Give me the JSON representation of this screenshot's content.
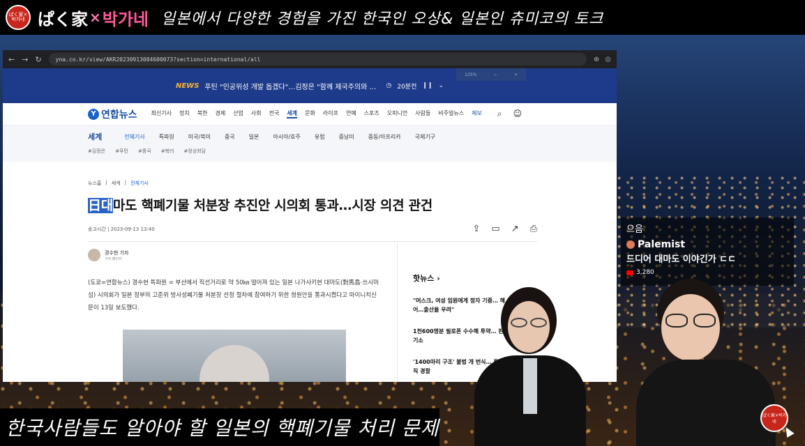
{
  "banner": {
    "brand_a": "ぱく家",
    "brand_x": "×",
    "brand_b": "박가네",
    "tagline": "일본에서 다양한 경험을 가진 한국인 오상& 일본인 츄미코의 토크",
    "logo_text": "ぱく家×박가네"
  },
  "browser": {
    "url": "yna.co.kr/view/AKR20230913084600073?section=international/all",
    "newsbar": {
      "label": "NEWS",
      "text": "푸틴 \"인공위성 개발 돕겠다\"…김정은 \"함께 제국주의와 …",
      "timer": "20분전",
      "zoom": "125%"
    },
    "site": {
      "logo_mark": "Y",
      "logo_name": "연합뉴스",
      "nav": [
        "최신기사",
        "정치",
        "북한",
        "경제",
        "산업",
        "사회",
        "전국",
        "세계",
        "문화",
        "라이프",
        "연예",
        "스포츠",
        "오피니언",
        "사람들",
        "비주얼뉴스",
        "제보"
      ],
      "active_nav": "세계"
    },
    "subnav": {
      "title": "세계",
      "items": [
        "전체기사",
        "특파원",
        "미국/북미",
        "중국",
        "일본",
        "아시아/호주",
        "유럽",
        "중남미",
        "중동/아프리카",
        "국제기구"
      ],
      "tags": [
        "#김정은",
        "#푸틴",
        "#중국",
        "#북러",
        "#정상회담"
      ]
    },
    "article": {
      "crumbs": [
        "뉴스홈",
        "세계",
        "전체기사"
      ],
      "headline_sel": "日대",
      "headline_rest": "마도 핵폐기물 처분장 추진안 시의회 통과…시장 의견 관건",
      "pubtime": "송고시간 | 2023-09-13 13:40",
      "reporter_name": "경수현 기자",
      "reporter_sub": "기자 페이지",
      "body": "(도쿄=연합뉴스) 경수현 특파원 = 부산에서 직선거리로 약 50㎞ 떨어져 있는 일본 나가사키현 대마도(對馬島·쓰시마섬) 시의회가 일본 정부의 고준위 방사성폐기물 처분장 선정 절차에 참여하기 위한 청원안을 통과시켰다고 마이니치신문이 13일 보도했다."
    },
    "sidebar": {
      "title": "핫뉴스",
      "items": [
        "\"머스크, 여성 임원에게 정자 기증… 해 쌍둥이 얻어…출산율 우려\"",
        "1천600명분 필로폰 수수해 투약… 판매한 명문대생 기소",
        "'1400마리 구조' 불법 개 번식… 투자·배당받은 현직 경찰"
      ]
    }
  },
  "chat": {
    "line1": "으음",
    "user": "Palemist",
    "message": "드디어 대마도 이야긴가 ㄷㄷ",
    "views": "3,280"
  },
  "subtitle": "한국사람들도 알아야 할 일본의 핵폐기물 처리 문제",
  "corner_logo_text": "ぱく家×박가네"
}
